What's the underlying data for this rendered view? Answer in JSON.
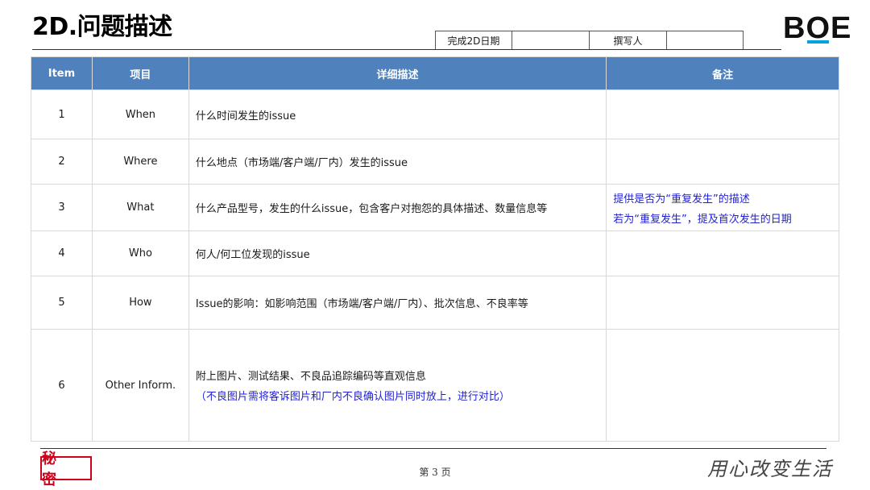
{
  "header": {
    "title": "2D.问题描述",
    "info": {
      "date_label": "完成2D日期",
      "date_value": "",
      "writer_label": "撰写人",
      "writer_value": ""
    },
    "logo": {
      "b": "B",
      "o": "O",
      "e": "E"
    }
  },
  "table": {
    "columns": [
      "Item",
      "项目",
      "详细描述",
      "备注"
    ],
    "rows": [
      {
        "num": "1",
        "item": "When",
        "desc": "什么时间发生的issue",
        "desc_extra": "",
        "note": "",
        "note_extra": ""
      },
      {
        "num": "2",
        "item": "Where",
        "desc": "什么地点（市场端/客户端/厂内）发生的issue",
        "desc_extra": "",
        "note": "",
        "note_extra": ""
      },
      {
        "num": "3",
        "item": "What",
        "desc": "什么产品型号，发生的什么issue，包含客户对抱怨的具体描述、数量信息等",
        "desc_extra": "",
        "note": "提供是否为“重复发生”的描述",
        "note_extra": "若为“重复发生”，提及首次发生的日期"
      },
      {
        "num": "4",
        "item": "Who",
        "desc": "何人/何工位发现的issue",
        "desc_extra": "",
        "note": "",
        "note_extra": ""
      },
      {
        "num": "5",
        "item": "How",
        "desc": "Issue的影响：如影响范围（市场端/客户端/厂内）、批次信息、不良率等",
        "desc_extra": "",
        "note": "",
        "note_extra": ""
      },
      {
        "num": "6",
        "item": "Other Inform.",
        "desc": "附上图片、测试结果、不良品追踪编码等直观信息",
        "desc_extra": "（不良图片需将客诉图片和厂内不良确认图片同时放上，进行对比）",
        "note": "",
        "note_extra": ""
      }
    ]
  },
  "footer": {
    "secret_label": "秘 密",
    "page_label": "第 3 页",
    "slogan": "用心改变生活"
  },
  "colors": {
    "header_bg": "#4f81bd",
    "note_text": "#1f1fd6",
    "secret_red": "#d0021b",
    "logo_accent": "#00a3e0"
  }
}
